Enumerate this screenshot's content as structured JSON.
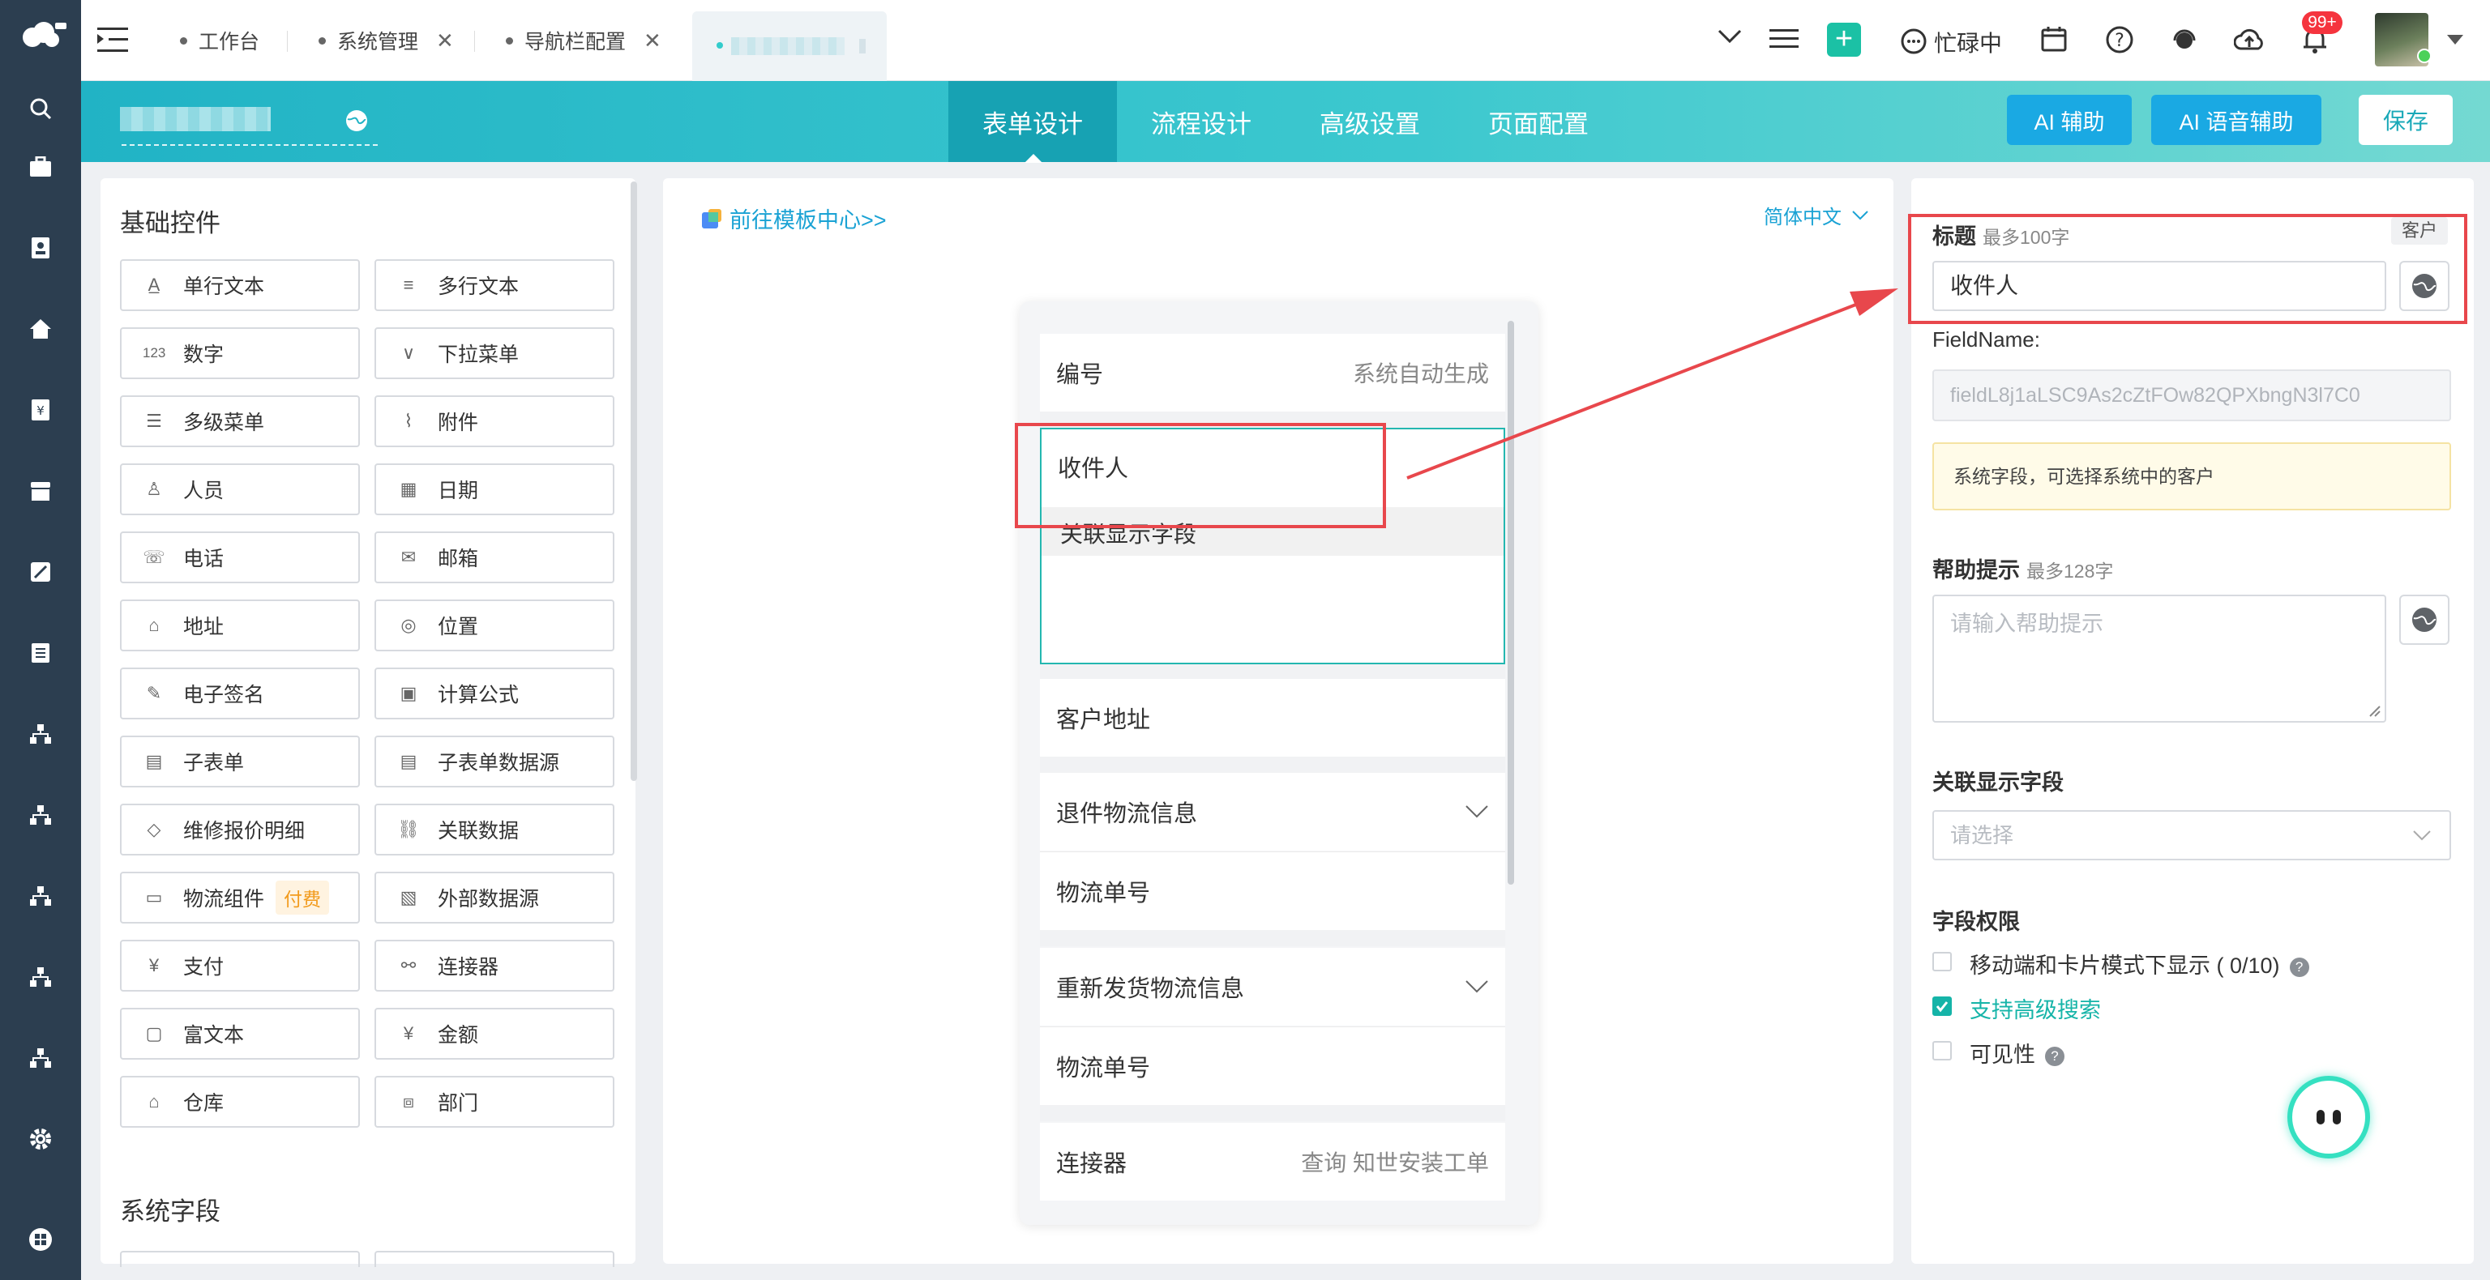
{
  "topbar": {
    "tabs": [
      {
        "label": "工作台",
        "closable": false
      },
      {
        "label": "系统管理",
        "closable": true
      },
      {
        "label": "导航栏配置",
        "closable": true
      },
      {
        "label": "",
        "closable": false
      }
    ],
    "status": "忙碌中",
    "badge": "99+"
  },
  "header": {
    "form_name": "",
    "nav": [
      "表单设计",
      "流程设计",
      "高级设置",
      "页面配置"
    ],
    "active_nav": "表单设计",
    "ai_assist": "AI 辅助",
    "ai_voice": "AI 语音辅助",
    "save": "保存"
  },
  "controls": {
    "basic_title": "基础控件",
    "items": [
      {
        "label": "单行文本",
        "icon": "single-line-text-icon"
      },
      {
        "label": "多行文本",
        "icon": "multi-line-text-icon"
      },
      {
        "label": "数字",
        "icon": "number-icon"
      },
      {
        "label": "下拉菜单",
        "icon": "dropdown-icon"
      },
      {
        "label": "多级菜单",
        "icon": "multi-level-menu-icon"
      },
      {
        "label": "附件",
        "icon": "attachment-icon"
      },
      {
        "label": "人员",
        "icon": "person-icon"
      },
      {
        "label": "日期",
        "icon": "calendar-icon"
      },
      {
        "label": "电话",
        "icon": "phone-icon"
      },
      {
        "label": "邮箱",
        "icon": "mail-icon"
      },
      {
        "label": "地址",
        "icon": "address-icon"
      },
      {
        "label": "位置",
        "icon": "location-icon"
      },
      {
        "label": "电子签名",
        "icon": "signature-icon"
      },
      {
        "label": "计算公式",
        "icon": "formula-icon"
      },
      {
        "label": "子表单",
        "icon": "subform-icon"
      },
      {
        "label": "子表单数据源",
        "icon": "subform-datasource-icon"
      },
      {
        "label": "维修报价明细",
        "icon": "box-icon"
      },
      {
        "label": "关联数据",
        "icon": "linked-data-icon"
      },
      {
        "label": "物流组件",
        "icon": "logistics-icon",
        "badge": "付费"
      },
      {
        "label": "外部数据源",
        "icon": "external-datasource-icon"
      },
      {
        "label": "支付",
        "icon": "payment-icon"
      },
      {
        "label": "连接器",
        "icon": "connector-icon"
      },
      {
        "label": "富文本",
        "icon": "rich-text-icon"
      },
      {
        "label": "金额",
        "icon": "amount-icon"
      },
      {
        "label": "仓库",
        "icon": "warehouse-icon"
      },
      {
        "label": "部门",
        "icon": "department-icon"
      }
    ],
    "system_title": "系统字段"
  },
  "canvas": {
    "template_link": "前往模板中心>>",
    "language": "简体中文",
    "fields": [
      {
        "label": "编号",
        "hint": "系统自动生成"
      },
      {
        "label": "收件人",
        "sub": "关联显示字段"
      },
      {
        "label": "客户地址"
      },
      {
        "label": "退件物流信息"
      },
      {
        "label": "物流单号"
      },
      {
        "label": "重新发货物流信息"
      },
      {
        "label": "物流单号"
      },
      {
        "label": "连接器",
        "hint": "查询 知世安装工单"
      }
    ]
  },
  "props": {
    "title_label": "标题",
    "title_limit": "最多100字",
    "tag": "客户",
    "title_value": "收件人",
    "fieldname_label": "FieldName:",
    "fieldname_value": "fieldL8j1aLSC9As2cZtFOw82QPXbngN3l7C0",
    "notice": "系统字段，可选择系统中的客户",
    "help_label": "帮助提示",
    "help_limit": "最多128字",
    "help_placeholder": "请输入帮助提示",
    "linked_label": "关联显示字段",
    "linked_placeholder": "请选择",
    "perm_label": "字段权限",
    "perm_items": [
      {
        "label": "移动端和卡片模式下显示 ( 0/10)",
        "checked": false,
        "help": true
      },
      {
        "label": "支持高级搜索",
        "checked": true,
        "help": false
      },
      {
        "label": "可见性",
        "checked": false,
        "help": true
      }
    ]
  },
  "colors": {
    "teal": "#21b3c5",
    "accent": "#15b4a8",
    "highlight": "#e8474c",
    "ai_button": "#1aa9e3"
  }
}
